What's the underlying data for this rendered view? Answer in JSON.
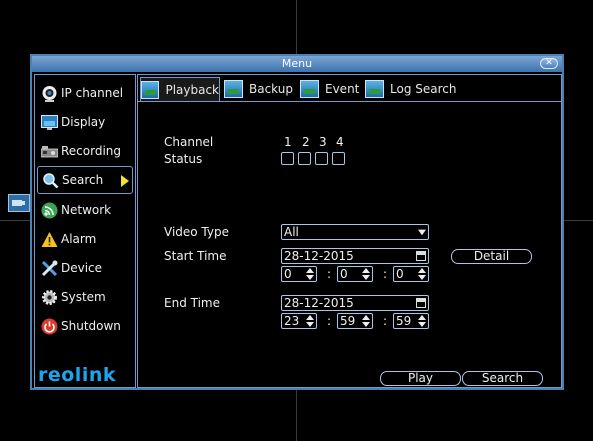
{
  "window": {
    "title": "Menu",
    "close_symbol": "✕"
  },
  "sidebar": {
    "items": [
      {
        "label": "IP channel",
        "icon": "camera-icon"
      },
      {
        "label": "Display",
        "icon": "monitor-icon"
      },
      {
        "label": "Recording",
        "icon": "recorder-icon"
      },
      {
        "label": "Search",
        "icon": "search-icon"
      },
      {
        "label": "Network",
        "icon": "network-icon"
      },
      {
        "label": "Alarm",
        "icon": "warning-icon"
      },
      {
        "label": "Device",
        "icon": "tools-icon"
      },
      {
        "label": "System",
        "icon": "gear-icon"
      },
      {
        "label": "Shutdown",
        "icon": "power-icon"
      }
    ],
    "active_index": 3,
    "logo": "reolink"
  },
  "tabs": [
    {
      "label": "Playback"
    },
    {
      "label": "Backup"
    },
    {
      "label": "Event"
    },
    {
      "label": "Log Search"
    }
  ],
  "playback": {
    "channel_label": "Channel",
    "status_label": "Status",
    "channels": [
      "1",
      "2",
      "3",
      "4"
    ],
    "video_type_label": "Video Type",
    "video_type_value": "All",
    "start_time_label": "Start Time",
    "start_date": "28-12-2015",
    "start_hour": "0",
    "start_minute": "0",
    "start_second": "0",
    "detail_button": "Detail",
    "end_time_label": "End Time",
    "end_date": "28-12-2015",
    "end_hour": "23",
    "end_minute": "59",
    "end_second": "59",
    "time_separator": ":",
    "play_button": "Play",
    "search_button": "Search"
  },
  "colors": {
    "accent": "#4d7fb0",
    "border": "#6f9ccc",
    "arrow": "#f4e22a",
    "logo": "#1fa3ec"
  }
}
